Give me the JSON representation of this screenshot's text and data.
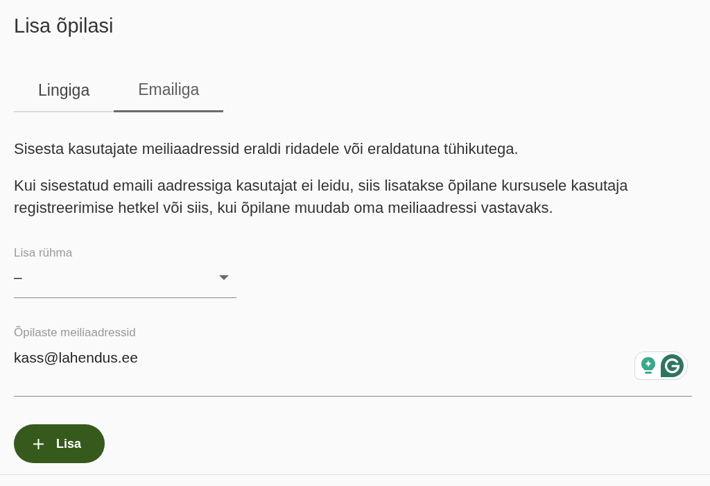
{
  "title": "Lisa õpilasi",
  "tabs": [
    {
      "label": "Lingiga",
      "selected": false
    },
    {
      "label": "Emailiga",
      "selected": true
    }
  ],
  "instructions": [
    "Sisesta kasutajate meiliaadressid eraldi ridadele või eraldatuna tühikutega.",
    "Kui sisestatud emaili aadressiga kasutajat ei leidu, siis lisatakse õpilane kursusele kasutaja registreerimise hetkel või siis, kui õpilane muudab oma meiliaadressi vastavaks."
  ],
  "group_select": {
    "label": "Lisa rühma",
    "value": "–"
  },
  "emails_field": {
    "label": "Õpilaste meiliaadressid",
    "value": "kass@lahendus.ee"
  },
  "add_button": {
    "label": "Lisa"
  }
}
